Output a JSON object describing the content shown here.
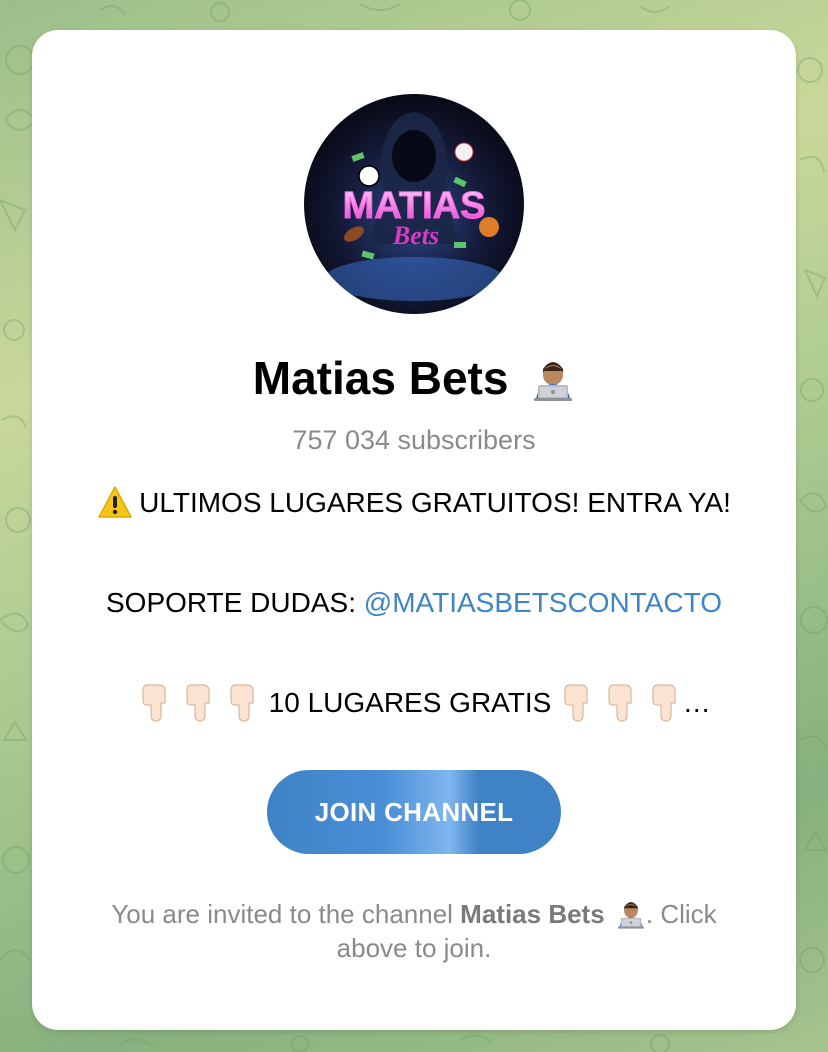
{
  "channel": {
    "name": "Matias Bets",
    "name_emoji": "technologist-emoji",
    "subscribers": "757 034 subscribers",
    "avatar_logo_top": "MATIAS",
    "avatar_logo_bottom": "Bets"
  },
  "description": {
    "line1_icon": "warning-emoji",
    "line1_text": "ULTIMOS LUGARES GRATUITOS! ENTRA YA!",
    "line2_prefix": "SOPORTE DUDAS: ",
    "line2_link": "@MATIASBETSCONTACTO",
    "line3_icon": "pointing-down-emoji",
    "line3_text": " 10 LUGARES GRATIS ",
    "line3_ellipsis": "…"
  },
  "join_button": {
    "label": "JOIN CHANNEL"
  },
  "footer": {
    "prefix": "You are invited to the channel ",
    "channel_name": "Matias Bets",
    "suffix_line1": ". Click",
    "suffix_line2": "above to join."
  },
  "colors": {
    "link": "#3d85c6",
    "button": "#3f82c6",
    "muted_text": "#8a8a8a",
    "card": "#ffffff"
  }
}
